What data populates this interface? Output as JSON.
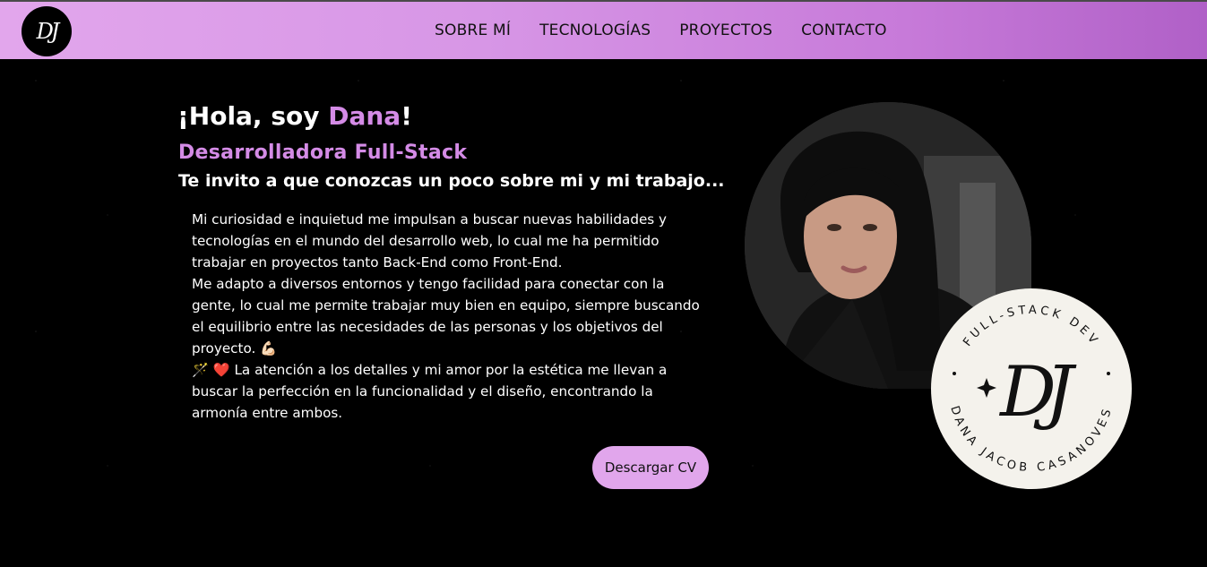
{
  "nav": {
    "logo": "DJ",
    "links": [
      "SOBRE MÍ",
      "TECNOLOGÍAS",
      "PROYECTOS",
      "CONTACTO"
    ]
  },
  "hero": {
    "greeting_prefix": "¡Hola, soy ",
    "greeting_name": "Dana",
    "greeting_suffix": "!",
    "role": "Desarrolladora Full-Stack",
    "invite": "Te invito a que conozcas un poco sobre mi y mi trabajo...",
    "bio": [
      "Mi curiosidad e inquietud me impulsan a buscar nuevas habilidades y tecnologías en el mundo del desarrollo web, lo cual me ha permitido trabajar en proyectos tanto Back-End como Front-End.",
      "Me adapto a diversos entornos y tengo facilidad para conectar con la gente, lo cual me permite trabajar muy bien en equipo, siempre buscando el equilibrio entre las necesidades de las personas y los objetivos del proyecto. 💪🏻",
      "🪄 ❤️ La atención a los detalles y mi amor por la estética me llevan a buscar la perfección en la funcionalidad y el diseño, encontrando la armonía entre ambos."
    ],
    "cv_button": "Descargar CV"
  },
  "badge": {
    "top_text": "FULL-STACK DEV",
    "bottom_text": "DANA JACOB CASANOVES",
    "monogram": "DJ"
  },
  "colors": {
    "accent": "#d48be6",
    "nav_gradient_start": "#e2a6ec",
    "nav_gradient_end": "#b060c7",
    "button_bg": "#e1a6ec"
  }
}
